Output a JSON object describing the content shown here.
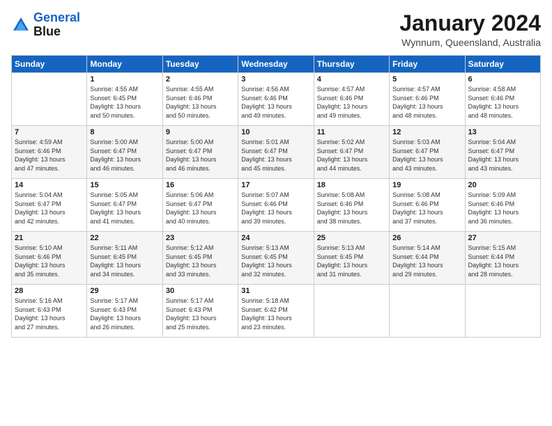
{
  "header": {
    "logo_line1": "General",
    "logo_line2": "Blue",
    "month": "January 2024",
    "location": "Wynnum, Queensland, Australia"
  },
  "days_of_week": [
    "Sunday",
    "Monday",
    "Tuesday",
    "Wednesday",
    "Thursday",
    "Friday",
    "Saturday"
  ],
  "weeks": [
    [
      {
        "num": "",
        "info": ""
      },
      {
        "num": "1",
        "info": "Sunrise: 4:55 AM\nSunset: 6:45 PM\nDaylight: 13 hours\nand 50 minutes."
      },
      {
        "num": "2",
        "info": "Sunrise: 4:55 AM\nSunset: 6:46 PM\nDaylight: 13 hours\nand 50 minutes."
      },
      {
        "num": "3",
        "info": "Sunrise: 4:56 AM\nSunset: 6:46 PM\nDaylight: 13 hours\nand 49 minutes."
      },
      {
        "num": "4",
        "info": "Sunrise: 4:57 AM\nSunset: 6:46 PM\nDaylight: 13 hours\nand 49 minutes."
      },
      {
        "num": "5",
        "info": "Sunrise: 4:57 AM\nSunset: 6:46 PM\nDaylight: 13 hours\nand 48 minutes."
      },
      {
        "num": "6",
        "info": "Sunrise: 4:58 AM\nSunset: 6:46 PM\nDaylight: 13 hours\nand 48 minutes."
      }
    ],
    [
      {
        "num": "7",
        "info": "Sunrise: 4:59 AM\nSunset: 6:46 PM\nDaylight: 13 hours\nand 47 minutes."
      },
      {
        "num": "8",
        "info": "Sunrise: 5:00 AM\nSunset: 6:47 PM\nDaylight: 13 hours\nand 46 minutes."
      },
      {
        "num": "9",
        "info": "Sunrise: 5:00 AM\nSunset: 6:47 PM\nDaylight: 13 hours\nand 46 minutes."
      },
      {
        "num": "10",
        "info": "Sunrise: 5:01 AM\nSunset: 6:47 PM\nDaylight: 13 hours\nand 45 minutes."
      },
      {
        "num": "11",
        "info": "Sunrise: 5:02 AM\nSunset: 6:47 PM\nDaylight: 13 hours\nand 44 minutes."
      },
      {
        "num": "12",
        "info": "Sunrise: 5:03 AM\nSunset: 6:47 PM\nDaylight: 13 hours\nand 43 minutes."
      },
      {
        "num": "13",
        "info": "Sunrise: 5:04 AM\nSunset: 6:47 PM\nDaylight: 13 hours\nand 43 minutes."
      }
    ],
    [
      {
        "num": "14",
        "info": "Sunrise: 5:04 AM\nSunset: 6:47 PM\nDaylight: 13 hours\nand 42 minutes."
      },
      {
        "num": "15",
        "info": "Sunrise: 5:05 AM\nSunset: 6:47 PM\nDaylight: 13 hours\nand 41 minutes."
      },
      {
        "num": "16",
        "info": "Sunrise: 5:06 AM\nSunset: 6:47 PM\nDaylight: 13 hours\nand 40 minutes."
      },
      {
        "num": "17",
        "info": "Sunrise: 5:07 AM\nSunset: 6:46 PM\nDaylight: 13 hours\nand 39 minutes."
      },
      {
        "num": "18",
        "info": "Sunrise: 5:08 AM\nSunset: 6:46 PM\nDaylight: 13 hours\nand 38 minutes."
      },
      {
        "num": "19",
        "info": "Sunrise: 5:08 AM\nSunset: 6:46 PM\nDaylight: 13 hours\nand 37 minutes."
      },
      {
        "num": "20",
        "info": "Sunrise: 5:09 AM\nSunset: 6:46 PM\nDaylight: 13 hours\nand 36 minutes."
      }
    ],
    [
      {
        "num": "21",
        "info": "Sunrise: 5:10 AM\nSunset: 6:46 PM\nDaylight: 13 hours\nand 35 minutes."
      },
      {
        "num": "22",
        "info": "Sunrise: 5:11 AM\nSunset: 6:45 PM\nDaylight: 13 hours\nand 34 minutes."
      },
      {
        "num": "23",
        "info": "Sunrise: 5:12 AM\nSunset: 6:45 PM\nDaylight: 13 hours\nand 33 minutes."
      },
      {
        "num": "24",
        "info": "Sunrise: 5:13 AM\nSunset: 6:45 PM\nDaylight: 13 hours\nand 32 minutes."
      },
      {
        "num": "25",
        "info": "Sunrise: 5:13 AM\nSunset: 6:45 PM\nDaylight: 13 hours\nand 31 minutes."
      },
      {
        "num": "26",
        "info": "Sunrise: 5:14 AM\nSunset: 6:44 PM\nDaylight: 13 hours\nand 29 minutes."
      },
      {
        "num": "27",
        "info": "Sunrise: 5:15 AM\nSunset: 6:44 PM\nDaylight: 13 hours\nand 28 minutes."
      }
    ],
    [
      {
        "num": "28",
        "info": "Sunrise: 5:16 AM\nSunset: 6:43 PM\nDaylight: 13 hours\nand 27 minutes."
      },
      {
        "num": "29",
        "info": "Sunrise: 5:17 AM\nSunset: 6:43 PM\nDaylight: 13 hours\nand 26 minutes."
      },
      {
        "num": "30",
        "info": "Sunrise: 5:17 AM\nSunset: 6:43 PM\nDaylight: 13 hours\nand 25 minutes."
      },
      {
        "num": "31",
        "info": "Sunrise: 5:18 AM\nSunset: 6:42 PM\nDaylight: 13 hours\nand 23 minutes."
      },
      {
        "num": "",
        "info": ""
      },
      {
        "num": "",
        "info": ""
      },
      {
        "num": "",
        "info": ""
      }
    ]
  ]
}
